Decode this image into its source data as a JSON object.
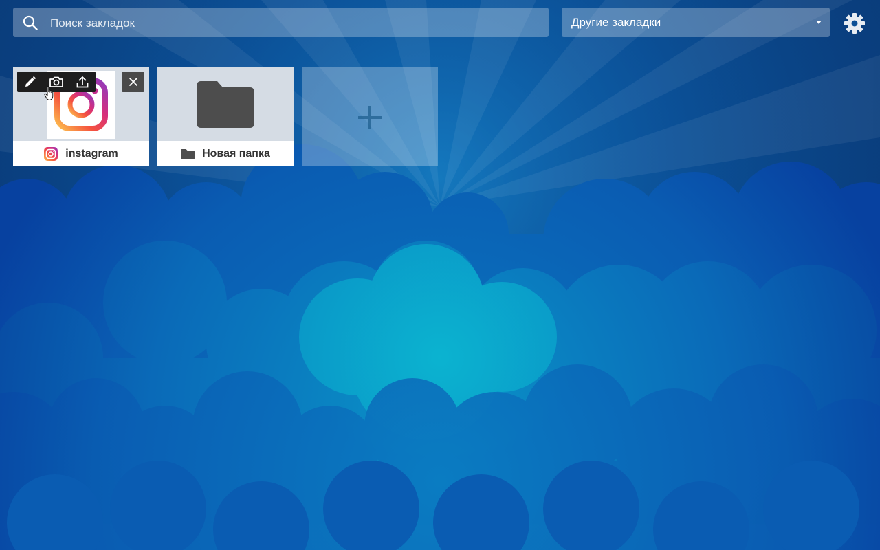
{
  "search": {
    "placeholder": "Поиск закладок",
    "icon": "search-icon"
  },
  "folder_select": {
    "selected": "Другие закладки",
    "icon": "chevron-down-icon"
  },
  "settings": {
    "icon": "gear-icon"
  },
  "tiles": [
    {
      "title": "instagram",
      "icon": "instagram-icon",
      "toolbar": [
        "pencil-icon",
        "camera-icon",
        "upload-icon"
      ],
      "close_icon": "close-icon"
    },
    {
      "title": "Новая папка",
      "icon": "folder-icon"
    }
  ],
  "add_tile": {
    "icon": "plus-icon"
  },
  "colors": {
    "background": "#0b4f95",
    "clouds_light": "#0aa6c8",
    "clouds_dark": "#0a4ea0",
    "tile_thumb": "#d5dce4",
    "folder": "#4d4d4d",
    "toolbar": "#1e1e1e"
  }
}
